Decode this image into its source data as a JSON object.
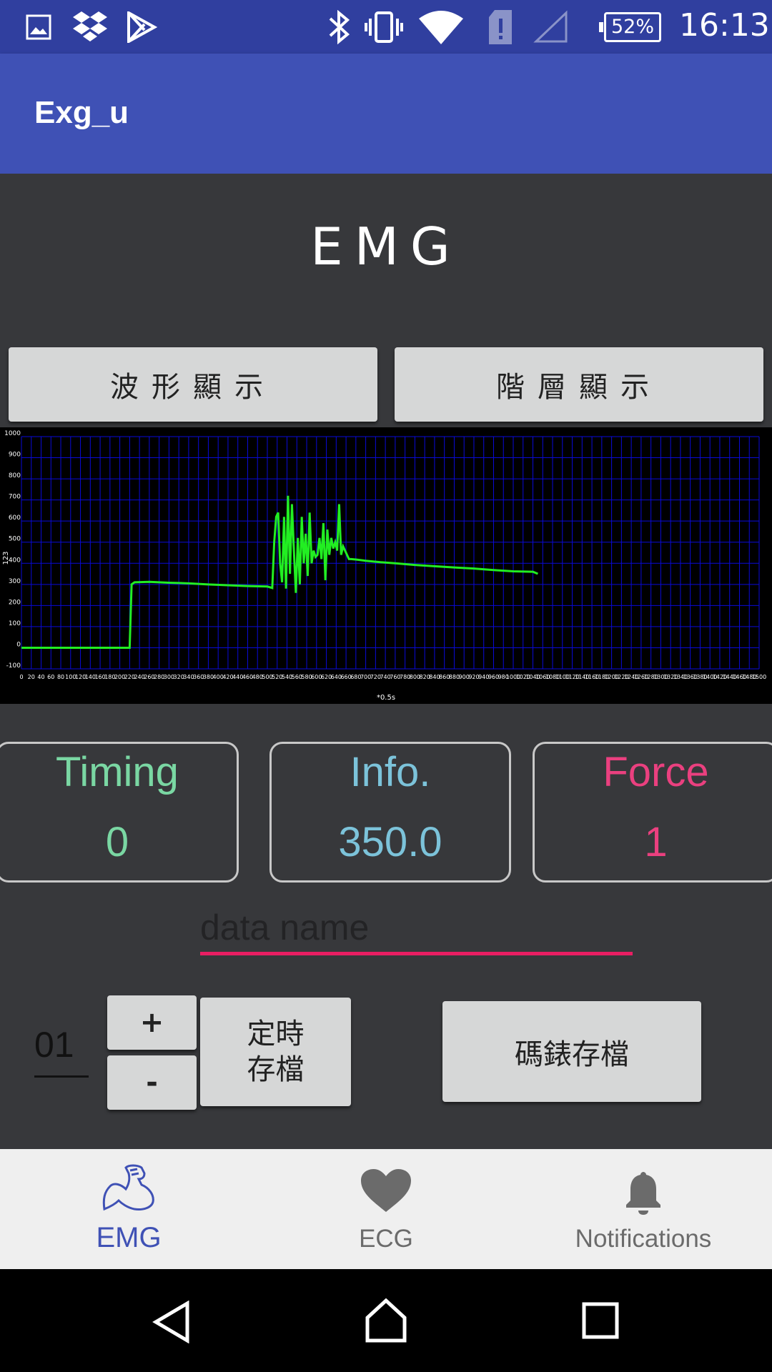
{
  "status_bar": {
    "battery": "52%",
    "time": "16:13",
    "icons": [
      "image-icon",
      "dropbox-icon",
      "play-store-icon",
      "bluetooth-icon",
      "vibrate-icon",
      "wifi-icon",
      "sim-alert-icon",
      "signal-icon",
      "battery-icon"
    ]
  },
  "app_bar": {
    "title": "Exg_u"
  },
  "page": {
    "heading": "EMG"
  },
  "buttons": {
    "waveform": "波形顯示",
    "level": "階層顯示",
    "plus": "+",
    "minus": "-",
    "timed_save_line1": "定時",
    "timed_save_line2": "存檔",
    "stopwatch_save": "碼錶存檔"
  },
  "chart_data": {
    "type": "line",
    "title": "",
    "xlabel": "*0.5s",
    "ylabel": "123",
    "xlim": [
      0,
      1500
    ],
    "ylim": [
      -100,
      1000
    ],
    "y_ticks": [
      -100,
      0,
      100,
      200,
      300,
      400,
      500,
      600,
      700,
      800,
      900,
      1000
    ],
    "x_tick_step": 20,
    "grid": true,
    "line_color": "#22ee22",
    "grid_color": "#0a0ad8",
    "series": [
      {
        "x": [
          0,
          60,
          120,
          180,
          220,
          224,
          230,
          260,
          300,
          340,
          380,
          420,
          460,
          500,
          510,
          514,
          518,
          522,
          526,
          530,
          534,
          538,
          542,
          546,
          550,
          554,
          558,
          562,
          566,
          570,
          574,
          578,
          582,
          586,
          590,
          594,
          598,
          602,
          606,
          610,
          614,
          618,
          622,
          626,
          630,
          634,
          638,
          642,
          646,
          650,
          654,
          658,
          662,
          666,
          670,
          680,
          700,
          730,
          760,
          800,
          840,
          880,
          920,
          960,
          1000,
          1040,
          1050
        ],
        "y": [
          0,
          0,
          0,
          0,
          0,
          300,
          310,
          312,
          308,
          305,
          300,
          296,
          292,
          290,
          283,
          500,
          620,
          640,
          400,
          310,
          620,
          280,
          720,
          350,
          680,
          460,
          260,
          520,
          300,
          620,
          400,
          540,
          340,
          640,
          400,
          460,
          430,
          440,
          520,
          420,
          590,
          320,
          560,
          440,
          520,
          470,
          500,
          460,
          680,
          440,
          480,
          460,
          440,
          420,
          420,
          418,
          412,
          405,
          400,
          392,
          386,
          380,
          375,
          368,
          362,
          360,
          350
        ]
      }
    ]
  },
  "stats": {
    "timing": {
      "label": "Timing",
      "value": "0",
      "color": "#7ad7a3"
    },
    "info": {
      "label": "Info.",
      "value": "350.0",
      "color": "#7cc3da"
    },
    "force": {
      "label": "Force",
      "value": "1",
      "color": "#ea407f"
    }
  },
  "data_name": {
    "placeholder": "data name",
    "value": ""
  },
  "counter": {
    "value": "01"
  },
  "bottom_nav": {
    "active_color": "#3f51b5",
    "inactive_color": "#6b6b6b",
    "items": [
      {
        "label": "EMG",
        "icon": "arm-muscle-icon",
        "active": true
      },
      {
        "label": "ECG",
        "icon": "heart-icon",
        "active": false
      },
      {
        "label": "Notifications",
        "icon": "bell-icon",
        "active": false
      }
    ]
  },
  "system_nav": {
    "icons": [
      "back-icon",
      "home-icon",
      "recents-icon"
    ]
  }
}
